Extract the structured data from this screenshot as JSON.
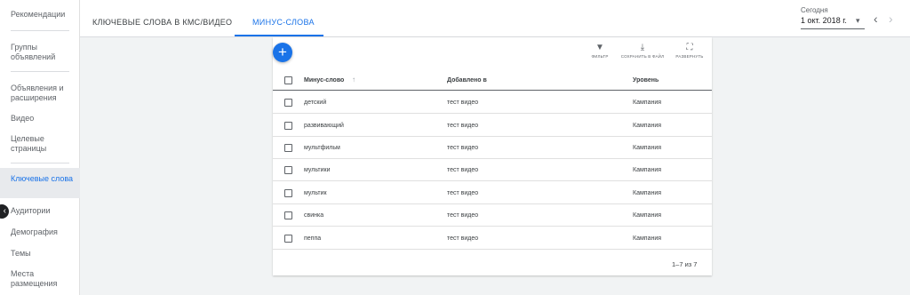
{
  "sidebar": {
    "items": [
      {
        "label": "Рекомендации"
      },
      {
        "label": "Группы объявлений"
      },
      {
        "label": "Объявления и расширения"
      },
      {
        "label": "Видео"
      },
      {
        "label": "Целевые страницы"
      },
      {
        "label": "Ключевые слова"
      },
      {
        "label": "Аудитории"
      },
      {
        "label": "Демография"
      },
      {
        "label": "Темы"
      },
      {
        "label": "Места размещения"
      }
    ],
    "active_index": 5
  },
  "header": {
    "tabs": [
      {
        "label": "КЛЮЧЕВЫЕ СЛОВА В КМС/ВИДЕО"
      },
      {
        "label": "МИНУС-СЛОВА"
      }
    ],
    "active_tab": 1,
    "date_caption": "Сегодня",
    "date_value": "1 окт. 2018 г."
  },
  "toolbar": {
    "filter_label": "ФИЛЬТР",
    "save_label": "СОХРАНИТЬ В ФАЙЛ",
    "expand_label": "РАЗВЕРНУТЬ"
  },
  "table": {
    "columns": [
      "Минус-слово",
      "Добавлено в",
      "Уровень"
    ],
    "rows": [
      {
        "keyword": "детский",
        "added_to": "тест видео",
        "level": "Кампания"
      },
      {
        "keyword": "развивающий",
        "added_to": "тест видео",
        "level": "Кампания"
      },
      {
        "keyword": "мультфильм",
        "added_to": "тест видео",
        "level": "Кампания"
      },
      {
        "keyword": "мультики",
        "added_to": "тест видео",
        "level": "Кампания"
      },
      {
        "keyword": "мультик",
        "added_to": "тест видео",
        "level": "Кампания"
      },
      {
        "keyword": "свинка",
        "added_to": "тест видео",
        "level": "Кампания"
      },
      {
        "keyword": "пеппа",
        "added_to": "тест видео",
        "level": "Кампания"
      }
    ],
    "pagination": "1–7 из 7"
  },
  "icons": {
    "add": "+",
    "filter": "▼",
    "download": "⤓",
    "expand": "⛶",
    "sort_up": "↑",
    "dropdown": "▾",
    "prev": "‹",
    "next": "›",
    "collapse": "‹"
  },
  "colors": {
    "accent": "#1a73e8",
    "active_nav_bg": "#e8eaed"
  }
}
